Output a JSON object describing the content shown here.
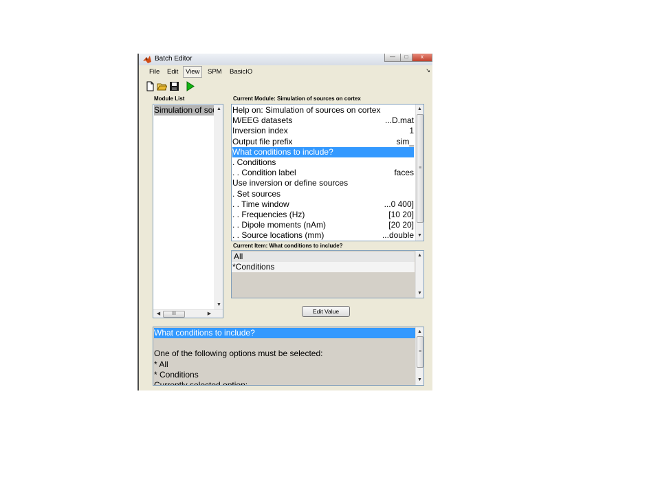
{
  "window": {
    "title": "Batch Editor",
    "buttons": {
      "minimize": "—",
      "maximize": "□",
      "close": "x"
    }
  },
  "menu": {
    "items": [
      "File",
      "Edit",
      "View",
      "SPM",
      "BasicIO"
    ],
    "active": "View",
    "overflow_arrow": "↘"
  },
  "toolbar": {
    "icons": [
      "new-file-icon",
      "open-folder-icon",
      "save-icon",
      "run-icon"
    ],
    "run_color": "#12b512"
  },
  "module_list": {
    "header": "Module List",
    "items": [
      "Simulation of sou"
    ],
    "scroll_grip": "III"
  },
  "current_module": {
    "header": "Current Module: Simulation of sources on cortex",
    "rows": [
      {
        "label": "Help on: Simulation of sources on cortex",
        "value": ""
      },
      {
        "label": "M/EEG datasets",
        "value": "...D.mat"
      },
      {
        "label": "Inversion index",
        "value": "1"
      },
      {
        "label": "Output file prefix",
        "value": "sim_"
      },
      {
        "label": "What conditions to include?",
        "value": ""
      },
      {
        "label": ". Conditions",
        "value": ""
      },
      {
        "label": ". . Condition label",
        "value": "faces"
      },
      {
        "label": "Use inversion or define sources",
        "value": ""
      },
      {
        "label": ". Set sources",
        "value": ""
      },
      {
        "label": ". . Time window",
        "value": "...0 400]"
      },
      {
        "label": ". . Frequencies (Hz)",
        "value": "[10 20]"
      },
      {
        "label": ". . Dipole moments (nAm)",
        "value": "[20 20]"
      },
      {
        "label": ". . Source locations (mm)",
        "value": "...double"
      }
    ],
    "selected_index": 4,
    "scroll_grip": "≡"
  },
  "current_item": {
    "header": "Current Item: What conditions to include?",
    "options": [
      "All",
      "*Conditions"
    ]
  },
  "edit_button": "Edit Value",
  "help": {
    "lines": [
      "What conditions to include?",
      "",
      "One of the following options must be selected:",
      "* All",
      "* Conditions",
      "Currently selected option:"
    ],
    "scroll_grip": "≡"
  },
  "colors": {
    "selection_blue": "#3399ff",
    "selection_grey": "#b4b4b4",
    "panel_bg": "#ece9d8",
    "help_bg": "#d4d0c8"
  }
}
